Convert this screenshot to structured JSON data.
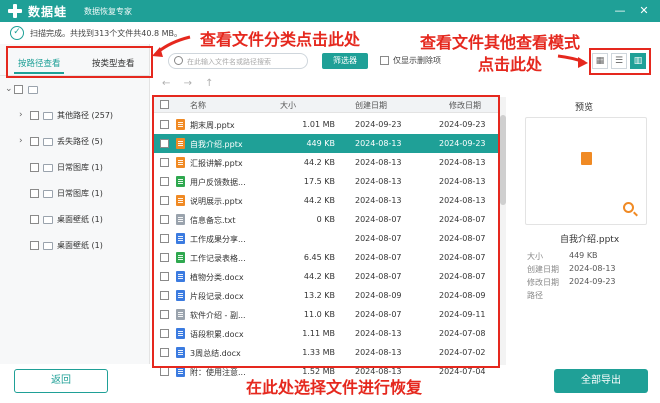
{
  "app": {
    "name": "数据蛙",
    "subtitle": "数据恢复专家",
    "status_text": "扫描完成。共找到313个文件共40.8 MB。"
  },
  "left_panel": {
    "tabs": [
      {
        "label": "按路径查看",
        "active": true
      },
      {
        "label": "按类型查看",
        "active": false
      }
    ],
    "tree": [
      {
        "label": "其他路径 (257)",
        "expandable": true
      },
      {
        "label": "丢失路径 (5)",
        "expandable": true
      },
      {
        "label": "日常图库 (1)",
        "expandable": false
      },
      {
        "label": "日常图库 (1)",
        "expandable": false
      },
      {
        "label": "桌面壁纸 (1)",
        "expandable": false
      },
      {
        "label": "桌面壁纸 (1)",
        "expandable": false
      }
    ]
  },
  "toolbar": {
    "search_placeholder": "在此输入文件名或路径搜索",
    "filter_label": "筛选器",
    "show_deleted_label": "仅显示删除项",
    "view_modes": [
      {
        "icon": "grid-view-icon",
        "glyph": "▦",
        "active": false
      },
      {
        "icon": "list-view-icon",
        "glyph": "☰",
        "active": false
      },
      {
        "icon": "preview-view-icon",
        "glyph": "▥",
        "active": true
      }
    ],
    "nav_glyphs": {
      "back": "←",
      "forward": "→",
      "up": "↑"
    }
  },
  "table": {
    "headers": {
      "name": "名称",
      "size": "大小",
      "created": "创建日期",
      "modified": "修改日期"
    },
    "rows": [
      {
        "name": "期末周.pptx",
        "size": "1.01 MB",
        "created": "2024-09-23",
        "modified": "2024-09-23",
        "icon_color": "#f08a24",
        "selected": false
      },
      {
        "name": "自我介绍.pptx",
        "size": "449 KB",
        "created": "2024-08-13",
        "modified": "2024-09-23",
        "icon_color": "#f08a24",
        "selected": true
      },
      {
        "name": "汇报讲解.pptx",
        "size": "44.2 KB",
        "created": "2024-08-13",
        "modified": "2024-08-13",
        "icon_color": "#f08a24",
        "selected": false
      },
      {
        "name": "用户反馈数据...",
        "size": "17.5 KB",
        "created": "2024-08-13",
        "modified": "2024-08-13",
        "icon_color": "#2fa84f",
        "selected": false
      },
      {
        "name": "说明展示.pptx",
        "size": "44.2 KB",
        "created": "2024-08-13",
        "modified": "2024-08-13",
        "icon_color": "#f08a24",
        "selected": false
      },
      {
        "name": "信息备忘.txt",
        "size": "0 KB",
        "created": "2024-08-07",
        "modified": "2024-08-07",
        "icon_color": "#9aa3ad",
        "selected": false
      },
      {
        "name": "工作成果分享...",
        "size": "",
        "created": "2024-08-07",
        "modified": "2024-08-07",
        "icon_color": "#3b7be0",
        "selected": false
      },
      {
        "name": "工作记录表格...",
        "size": "6.45 KB",
        "created": "2024-08-07",
        "modified": "2024-08-07",
        "icon_color": "#2fa84f",
        "selected": false
      },
      {
        "name": "植物分类.docx",
        "size": "44.2 KB",
        "created": "2024-08-07",
        "modified": "2024-08-07",
        "icon_color": "#3b7be0",
        "selected": false
      },
      {
        "name": "片段记录.docx",
        "size": "13.2 KB",
        "created": "2024-08-09",
        "modified": "2024-08-09",
        "icon_color": "#3b7be0",
        "selected": false
      },
      {
        "name": "软件介绍 - 副...",
        "size": "11.0 KB",
        "created": "2024-08-07",
        "modified": "2024-09-11",
        "icon_color": "#9aa3ad",
        "selected": false
      },
      {
        "name": "语段积累.docx",
        "size": "1.11 MB",
        "created": "2024-08-13",
        "modified": "2024-07-08",
        "icon_color": "#3b7be0",
        "selected": false
      },
      {
        "name": "3周总结.docx",
        "size": "1.33 MB",
        "created": "2024-08-13",
        "modified": "2024-07-02",
        "icon_color": "#3b7be0",
        "selected": false
      },
      {
        "name": "附：使用注意...",
        "size": "1.52 MB",
        "created": "2024-08-13",
        "modified": "2024-07-04",
        "icon_color": "#3b7be0",
        "selected": false
      }
    ]
  },
  "preview": {
    "title": "预览",
    "file_name": "自我介绍.pptx",
    "meta": [
      {
        "label": "大小",
        "value": "449 KB"
      },
      {
        "label": "创建日期",
        "value": "2024-08-13"
      },
      {
        "label": "修改日期",
        "value": "2024-09-23"
      },
      {
        "label": "路径",
        "value": ""
      }
    ]
  },
  "buttons": {
    "back_label": "返回",
    "export_label": "全部导出"
  },
  "annotations": {
    "category_hint": "查看文件分类点击此处",
    "view_mode_hint_line1": "查看文件其他查看模式",
    "view_mode_hint_line2": "点击此处",
    "select_hint": "在此处选择文件进行恢复"
  },
  "colors": {
    "accent": "#1fa097",
    "annotation_red": "#e5281e"
  }
}
